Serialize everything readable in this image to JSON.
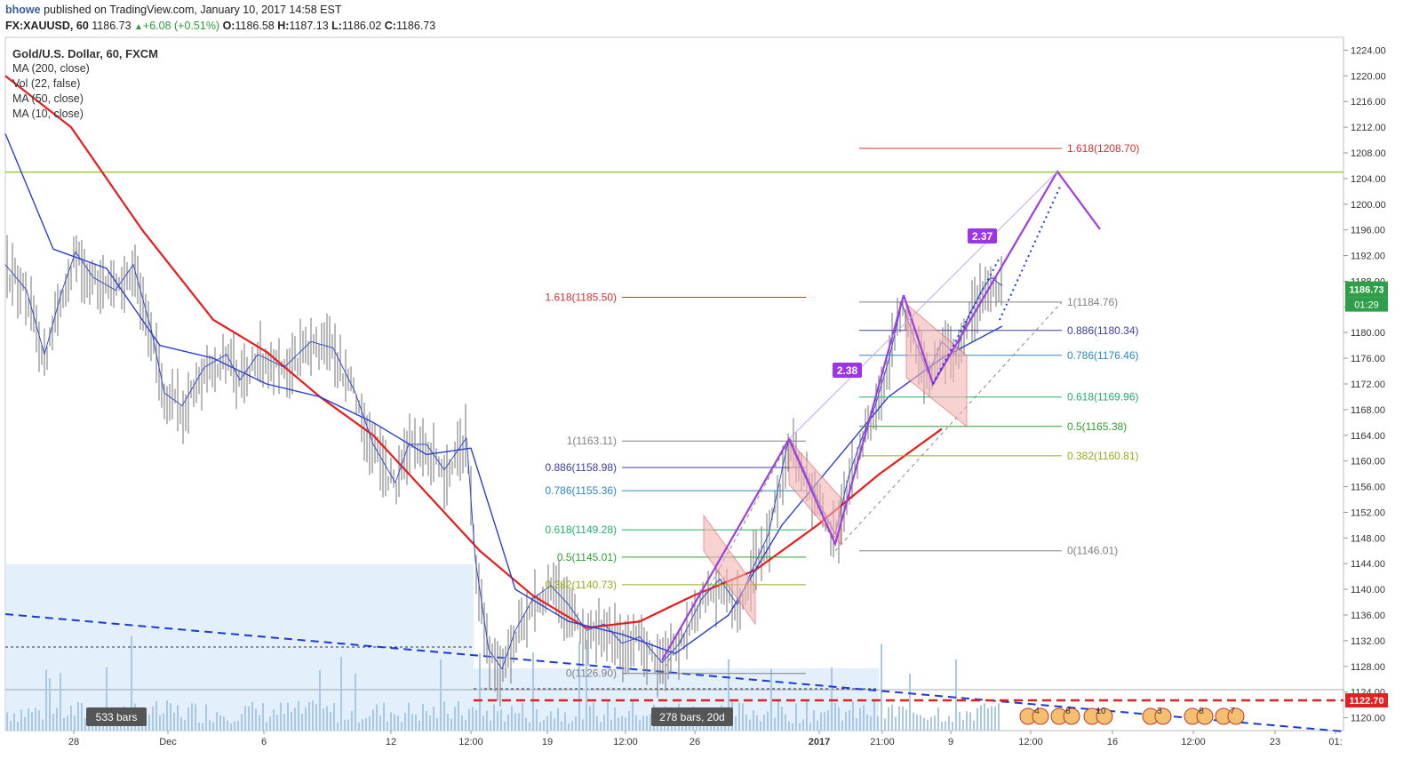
{
  "header": {
    "user": "bhowe",
    "published": "published on TradingView.com, January 10, 2017 14:58 EST",
    "symbol": "FX:XAUUSD, 60",
    "last": "1186.73",
    "change": "+6.08 (+0.51%)",
    "o_label": "O:",
    "o": "1186.58",
    "h_label": "H:",
    "h": "1187.13",
    "l_label": "L:",
    "l": "1186.02",
    "c_label": "C:",
    "c": "1186.73"
  },
  "legend": {
    "title": "Gold/U.S. Dollar, 60, FXCM",
    "items": [
      "MA (200, close)",
      "Vol (22, false)",
      "MA (50, close)",
      "MA (10, close)"
    ]
  },
  "colors": {
    "candle": "#8a8a8a",
    "ma200": "#e81c1c",
    "ma50": "#2b3fd0",
    "ma10": "#2b3fd0",
    "pattern": "#a03de0",
    "horizontal_level": "#9ccc3a",
    "fib_1": "#808080",
    "fib_0886": "#3b3fa0",
    "fib_0786": "#2c89c4",
    "fib_0618": "#1fb06a",
    "fib_05": "#2f9e2f",
    "fib_0382": "#9aaa1a",
    "fib_1618": "#d63030"
  },
  "chart_data": {
    "type": "line",
    "title": "Gold/U.S. Dollar, 60, FXCM",
    "series": [
      {
        "name": "MA (200, close)",
        "values_approx": [
          1220,
          1212,
          1196,
          1182,
          1177,
          1170,
          1164,
          1155,
          1146,
          1139,
          1134,
          1135,
          1139,
          1143,
          1150,
          1158,
          1165
        ]
      },
      {
        "name": "MA (50, close)",
        "values_approx": [
          1211,
          1193,
          1184,
          1178,
          1176,
          1172,
          1164,
          1161,
          1140,
          1136,
          1133,
          1136,
          1150,
          1160,
          1170,
          1176,
          1181
        ]
      }
    ],
    "ylim": [
      1118,
      1226
    ],
    "y_ticks": [
      "1224.00",
      "1220.00",
      "1216.00",
      "1212.00",
      "1208.00",
      "1204.00",
      "1200.00",
      "1196.00",
      "1192.00",
      "1188.00",
      "1184.00",
      "1180.00",
      "1176.00",
      "1172.00",
      "1168.00",
      "1164.00",
      "1160.00",
      "1156.00",
      "1152.00",
      "1148.00",
      "1144.00",
      "1140.00",
      "1136.00",
      "1132.00",
      "1128.00",
      "1124.00",
      "1120.00"
    ],
    "x_ticks": [
      "28",
      "Dec",
      "6",
      "12",
      "12:00",
      "19",
      "12:00",
      "26",
      "2017",
      "21:00",
      "9",
      "12:00",
      "16",
      "12:00",
      "23",
      "01:"
    ],
    "price_label": "1186.73",
    "countdown_label": "01:29",
    "alert_level": {
      "label": "1122.70",
      "value": 1122.7
    },
    "resistance_level": 1205.0,
    "fib_left": {
      "levels": [
        {
          "label": "1(1163.11)",
          "value": 1163.11,
          "key": "fib_1"
        },
        {
          "label": "0.886(1158.98)",
          "value": 1158.98,
          "key": "fib_0886"
        },
        {
          "label": "0.786(1155.36)",
          "value": 1155.36,
          "key": "fib_0786"
        },
        {
          "label": "0.618(1149.28)",
          "value": 1149.28,
          "key": "fib_0618"
        },
        {
          "label": "0.5(1145.01)",
          "value": 1145.01,
          "key": "fib_05"
        },
        {
          "label": "0.382(1140.73)",
          "value": 1140.73,
          "key": "fib_0382"
        },
        {
          "label": "0(1126.90)",
          "value": 1126.9,
          "key": "fib_1"
        }
      ],
      "extension": {
        "label": "1.618(1185.50)",
        "value": 1185.5
      }
    },
    "fib_right": {
      "levels": [
        {
          "label": "1(1184.76)",
          "value": 1184.76,
          "key": "fib_1"
        },
        {
          "label": "0.886(1180.34)",
          "value": 1180.34,
          "key": "fib_0886"
        },
        {
          "label": "0.786(1176.46)",
          "value": 1176.46,
          "key": "fib_0786"
        },
        {
          "label": "0.618(1169.96)",
          "value": 1169.96,
          "key": "fib_0618"
        },
        {
          "label": "0.5(1165.38)",
          "value": 1165.38,
          "key": "fib_05"
        },
        {
          "label": "0.382(1160.81)",
          "value": 1160.81,
          "key": "fib_0382"
        },
        {
          "label": "0(1146.01)",
          "value": 1146.01,
          "key": "fib_1"
        }
      ],
      "extension": {
        "label": "1.618(1208.70)",
        "value": 1208.7
      }
    },
    "annotations": [
      "2.38",
      "2.37",
      "533 bars",
      "278 bars, 20d"
    ],
    "event_flags": [
      "4",
      "8",
      "10",
      "3",
      "8",
      "7"
    ]
  }
}
